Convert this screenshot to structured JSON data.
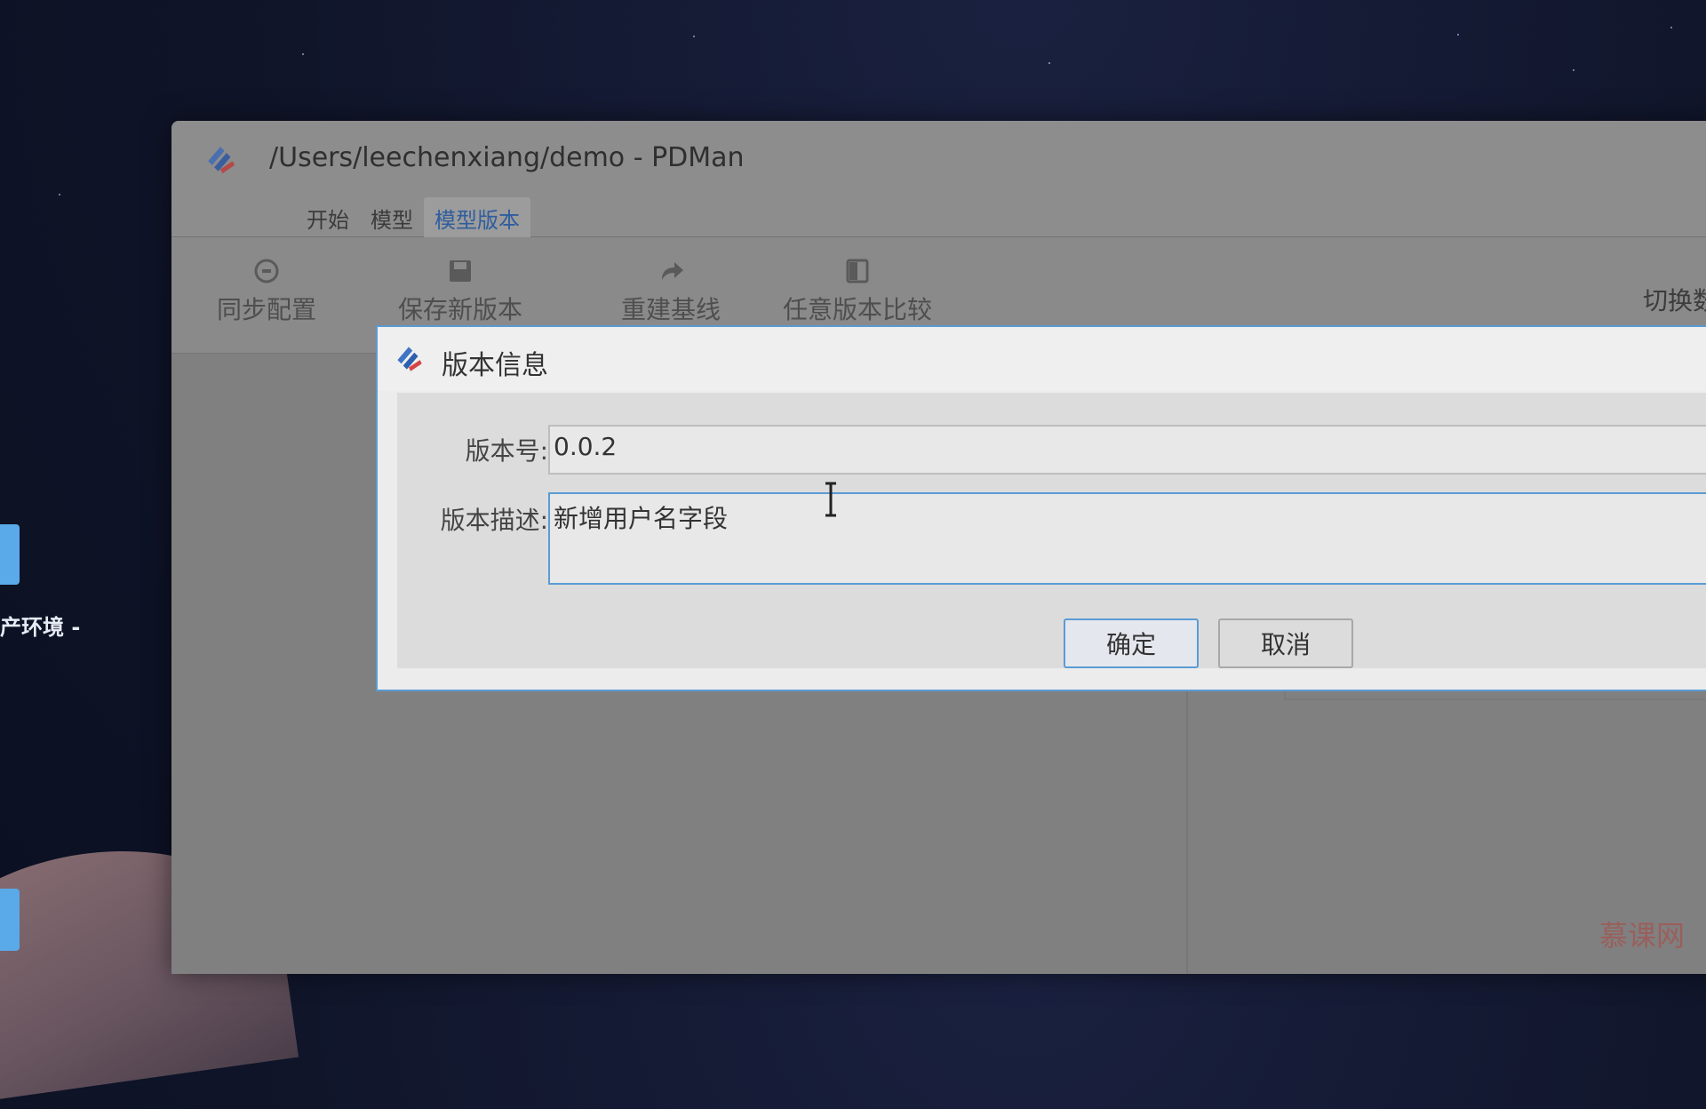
{
  "desktop": {
    "side_label": "产环境 -"
  },
  "window": {
    "title": "/Users/leechenxiang/demo - PDMan",
    "menu": [
      {
        "label": "开始"
      },
      {
        "label": "模型"
      },
      {
        "label": "模型版本"
      }
    ],
    "toolbar": [
      {
        "label": "同步配置",
        "icon": "sync-icon"
      },
      {
        "label": "保存新版本",
        "icon": "save-icon"
      },
      {
        "label": "重建基线",
        "icon": "redo-icon"
      },
      {
        "label": "任意版本比较",
        "icon": "compare-icon"
      }
    ],
    "toolbar_right": "切换数"
  },
  "dialog": {
    "title": "版本信息",
    "version_label": "版本号:",
    "version_value": "0.0.2",
    "desc_label": "版本描述:",
    "desc_value": "新增用户名字段",
    "ok_label": "确定",
    "cancel_label": "取消"
  },
  "watermark": "慕课网",
  "colors": {
    "accent": "#5b9bd5",
    "menu_active": "#2f5d9e"
  }
}
